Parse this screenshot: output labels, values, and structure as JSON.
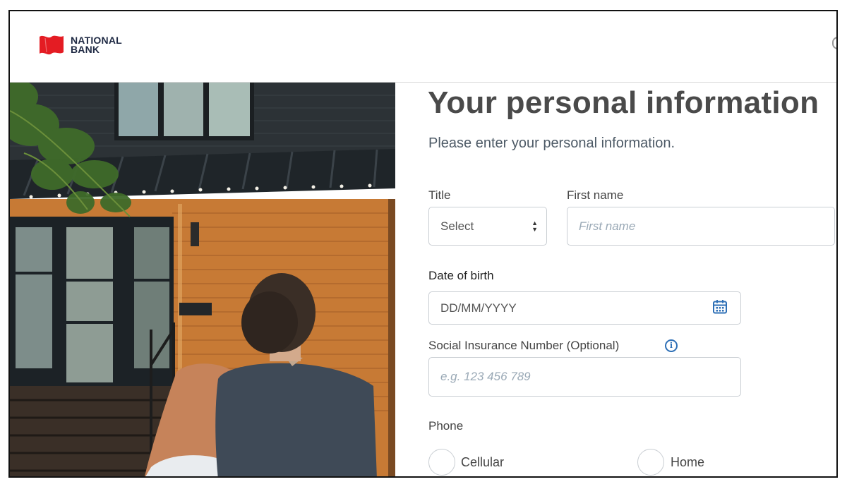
{
  "header": {
    "brand_line1": "NATIONAL",
    "brand_line2": "BANK",
    "logo_icon": "national-bank-flag-logo",
    "brand_color": "#e41c23"
  },
  "form": {
    "title": "Your personal information",
    "subtitle": "Please enter your personal information.",
    "title_field": {
      "label": "Title",
      "value": "Select"
    },
    "first_name": {
      "label": "First name",
      "placeholder": "First name"
    },
    "dob": {
      "label": "Date of birth",
      "value": "DD/MM/YYYY",
      "icon": "calendar-icon"
    },
    "sin": {
      "label": "Social Insurance Number (Optional)",
      "placeholder": "e.g. 123 456 789",
      "info_glyph": "i"
    },
    "phone": {
      "label": "Phone",
      "options": [
        {
          "label": "Cellular"
        },
        {
          "label": "Home"
        }
      ]
    }
  },
  "colors": {
    "accent": "#2d6fb6",
    "placeholder": "#9aa9b6",
    "border": "#c9ced3"
  }
}
